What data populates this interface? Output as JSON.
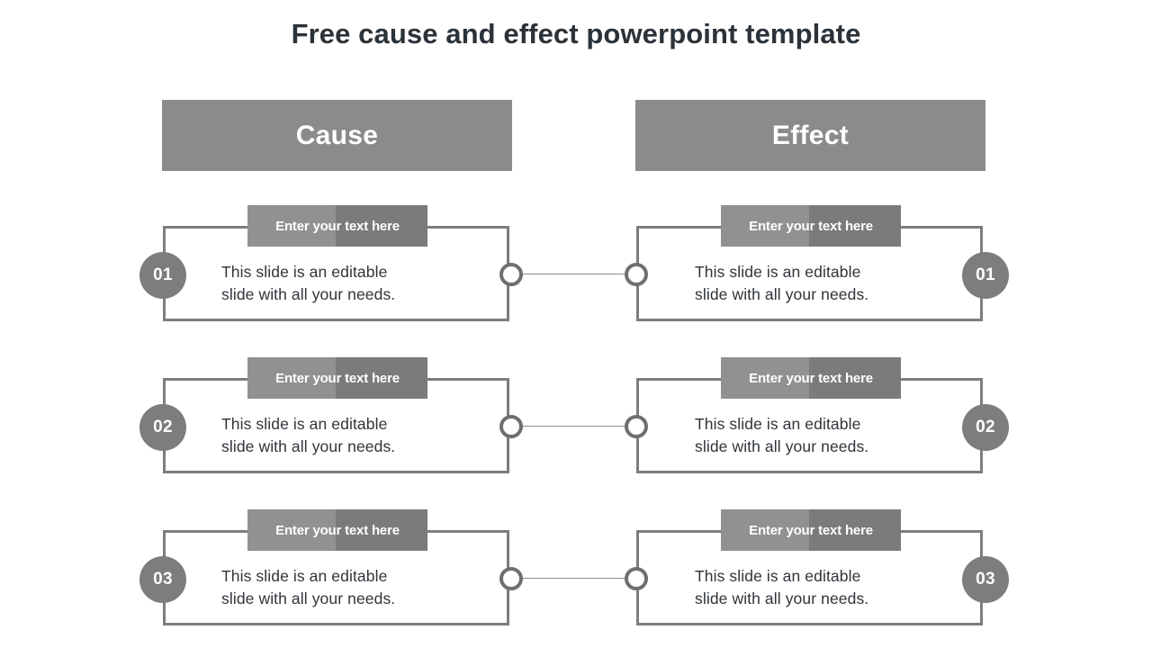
{
  "slide": {
    "title": "Free cause and effect powerpoint template",
    "background_color": "#ffffff",
    "title_color": "#2b3238"
  },
  "theme": {
    "header_bar_color": "#8b8b8b",
    "label_tab_light": "#919191",
    "label_tab_dark": "#7b7b7b",
    "outline_color": "#7d7d7d",
    "badge_color": "#7d7d7d",
    "ring_stroke_color": "#6f6f6f",
    "connector_line_color": "#8d8d8d",
    "body_text_color": "#2f353b",
    "on_dark_text_color": "#ffffff"
  },
  "columns": {
    "left": {
      "header": "Cause"
    },
    "right": {
      "header": "Effect"
    }
  },
  "rows": [
    {
      "left": {
        "number": "01",
        "label": "Enter your text here",
        "body": "This slide is an editable\nslide with all  your needs."
      },
      "right": {
        "number": "01",
        "label": "Enter your text here",
        "body": "This slide is an editable\nslide with all  your needs."
      }
    },
    {
      "left": {
        "number": "02",
        "label": "Enter your text here",
        "body": "This slide is an editable\nslide with all  your needs."
      },
      "right": {
        "number": "02",
        "label": "Enter your text here",
        "body": "This slide is an editable\nslide with all  your needs."
      }
    },
    {
      "left": {
        "number": "03",
        "label": "Enter your text here",
        "body": "This slide is an editable\nslide with all  your needs."
      },
      "right": {
        "number": "03",
        "label": "Enter your text here",
        "body": "This slide is an editable\nslide with all  your needs."
      }
    }
  ]
}
